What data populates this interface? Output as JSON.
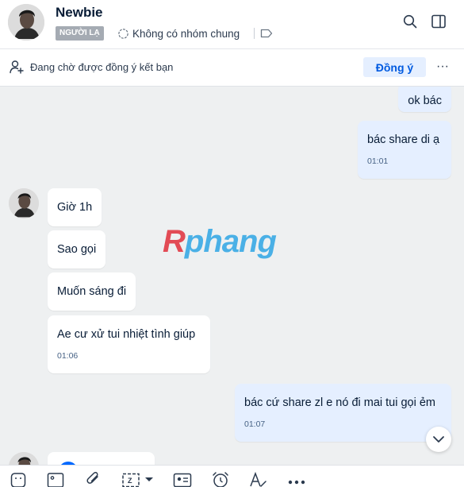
{
  "header": {
    "name": "Newbie",
    "badge": "NGƯỜI LẠ",
    "groups_text": "Không có nhóm chung",
    "icons": [
      "search-icon",
      "sidebar-toggle-icon",
      "tag-icon",
      "group-icon"
    ]
  },
  "friend_request": {
    "text": "Đang chờ được đồng ý kết bạn",
    "accept_label": "Đồng ý",
    "more_label": "···"
  },
  "messages": [
    {
      "side": "mine",
      "text": "ok bác"
    },
    {
      "side": "mine",
      "text": "bác share di ạ",
      "time": "01:01"
    },
    {
      "side": "theirs",
      "text": "Giờ 1h"
    },
    {
      "side": "theirs",
      "text": "Sao gọi"
    },
    {
      "side": "theirs",
      "text": "Muốn sáng đi"
    },
    {
      "side": "theirs",
      "text": "Ae cư xử tui nhiệt tình giúp",
      "time": "01:06"
    },
    {
      "side": "mine",
      "text": "bác cứ share zl e nó đi mai tui gọi ẻm",
      "time": "01:07"
    }
  ],
  "watermark": {
    "first": "R",
    "rest": "phang"
  },
  "toolbar": {
    "icons": [
      "sticker-icon",
      "image-icon",
      "attachment-icon",
      "screenshot-icon",
      "contact-card-icon",
      "reminder-icon",
      "text-format-icon",
      "more-icon"
    ]
  },
  "colors": {
    "accent": "#005ae0",
    "mine_bubble": "#e5efff",
    "chat_bg": "#eef0f1",
    "badge_bg": "#a5abb3"
  }
}
